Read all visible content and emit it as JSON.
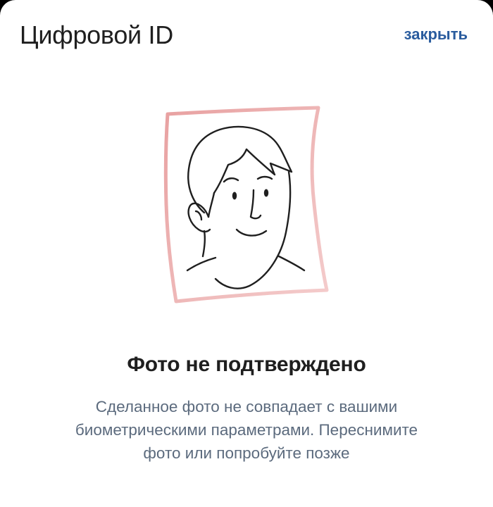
{
  "header": {
    "title": "Цифровой ID",
    "close_label": "закрыть"
  },
  "illustration": {
    "icon": "face-photo-illustration",
    "frame_color_start": "#e8a1a1",
    "frame_color_end": "#f4cccc",
    "stroke_color": "#1f1f1f"
  },
  "result": {
    "title": "Фото не подтверждено",
    "message": "Сделанное фото не совпадает с вашими биометрическими параметрами. Переснимите фото или попробуйте позже"
  },
  "colors": {
    "accent": "#2a5c9e",
    "text_primary": "#1f1f1f",
    "text_secondary": "#5b6a7d",
    "background": "#ffffff"
  }
}
